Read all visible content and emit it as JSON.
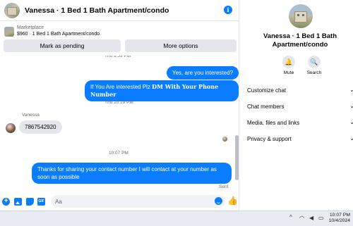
{
  "header": {
    "title": "Vanessa · 1 Bed 1 Bath Apartment/condo"
  },
  "marketplace": {
    "label": "Marketplace",
    "listing": "$960 · 1 Bed 1 Bath Apartment/condo",
    "pending_button": "Mark as pending",
    "more_button": "More options"
  },
  "messages": {
    "top_timestamp_partial": "Thu 9:59 PM",
    "outgoing_1": "Yes, are you interested?",
    "outgoing_2_prefix": "If You Are interested Plz ",
    "outgoing_2_bold": "DM With Your Phone Number",
    "timestamp_2": "Thu 10:19 PM",
    "sender_name": "Vanessa",
    "incoming_1": "7867542920",
    "timestamp_3": "10:07 PM",
    "outgoing_3": "Thanks for sharing your contact number I will contact at your number as soon as possible",
    "status": "Sent"
  },
  "composer": {
    "placeholder": "Aa"
  },
  "info_panel": {
    "title": "Vanessa · 1 Bed 1 Bath Apartment/condo",
    "mute_label": "Mute",
    "search_label": "Search",
    "menu": [
      "Customize chat",
      "Chat members",
      "Media, files and links",
      "Privacy & support"
    ]
  },
  "taskbar": {
    "time": "10:07 PM",
    "date": "10/4/2024"
  },
  "colors": {
    "accent": "#0a7cff",
    "bubble_incoming": "#e4e6eb",
    "panel_border": "#e4e6eb"
  }
}
